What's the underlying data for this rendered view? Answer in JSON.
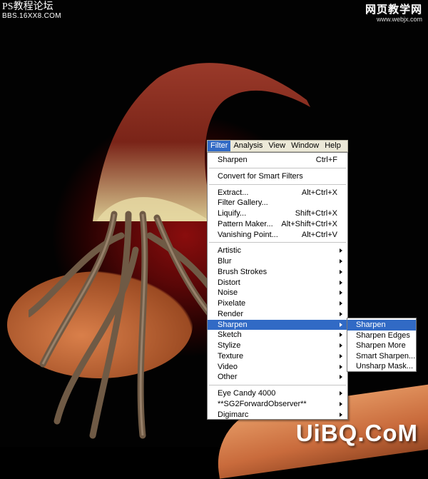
{
  "watermarks": {
    "top_left_line1": "PS教程论坛",
    "top_left_line2": "BBS.16XX8.COM",
    "top_right_line1": "网页教学网",
    "top_right_line2": "www.webjx.com",
    "bottom_right": "UiBQ.CoM"
  },
  "menubar": {
    "items": [
      "Filter",
      "Analysis",
      "View",
      "Window",
      "Help"
    ],
    "active": "Filter"
  },
  "filter_menu": {
    "last_filter": {
      "label": "Sharpen",
      "shortcut": "Ctrl+F"
    },
    "convert_smart": "Convert for Smart Filters",
    "tools": [
      {
        "label": "Extract...",
        "shortcut": "Alt+Ctrl+X"
      },
      {
        "label": "Filter Gallery...",
        "shortcut": ""
      },
      {
        "label": "Liquify...",
        "shortcut": "Shift+Ctrl+X"
      },
      {
        "label": "Pattern Maker...",
        "shortcut": "Alt+Shift+Ctrl+X"
      },
      {
        "label": "Vanishing Point...",
        "shortcut": "Alt+Ctrl+V"
      }
    ],
    "categories": [
      "Artistic",
      "Blur",
      "Brush Strokes",
      "Distort",
      "Noise",
      "Pixelate",
      "Render",
      "Sharpen",
      "Sketch",
      "Stylize",
      "Texture",
      "Video",
      "Other"
    ],
    "highlighted_category": "Sharpen",
    "plugins": [
      "Eye Candy 4000",
      "**SG2ForwardObserver**",
      "Digimarc"
    ]
  },
  "sharpen_submenu": {
    "items": [
      "Sharpen",
      "Sharpen Edges",
      "Sharpen More",
      "Smart Sharpen...",
      "Unsharp Mask..."
    ],
    "highlighted": "Sharpen"
  },
  "colors": {
    "menu_highlight": "#316ac5",
    "menubar_bg": "#ece9d8",
    "background_red": "#8a0d0d"
  }
}
